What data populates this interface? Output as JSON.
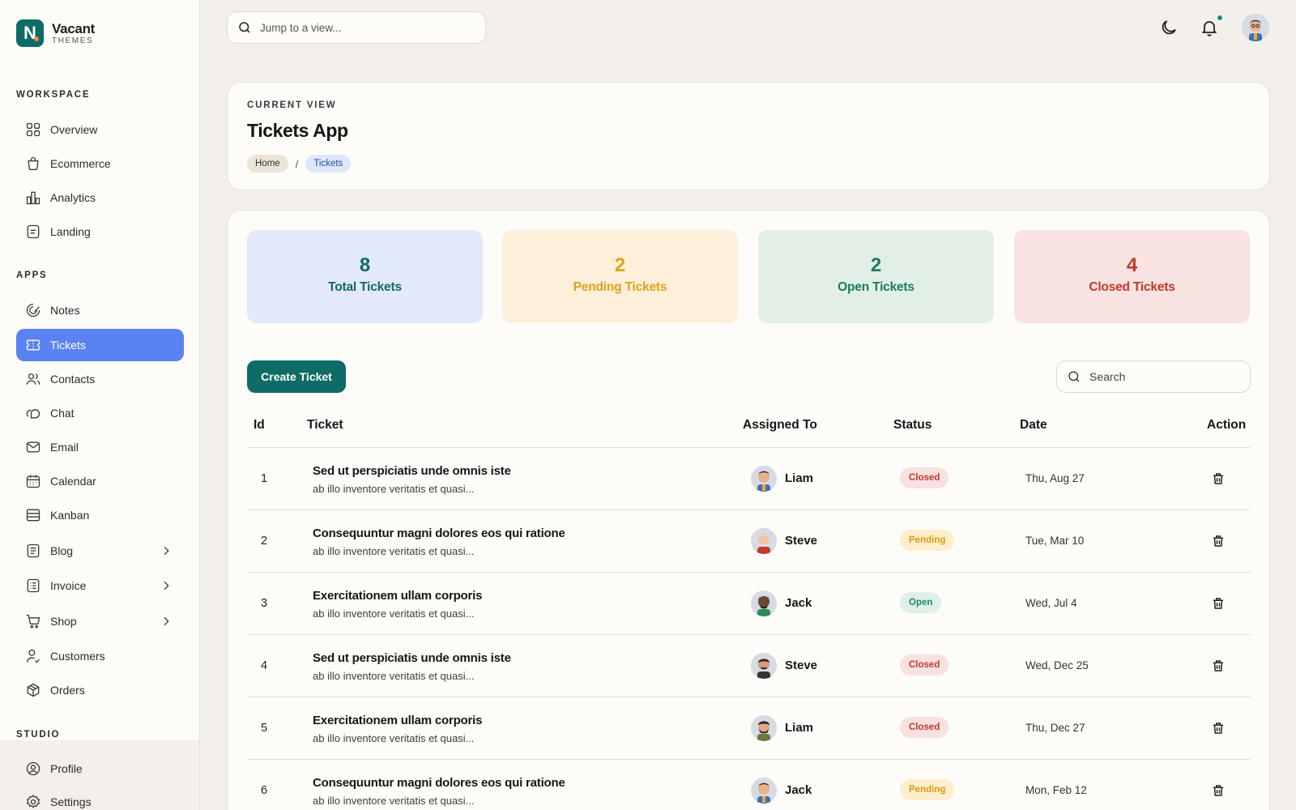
{
  "brand": {
    "name": "Vacant",
    "sub": "THEMES",
    "logo_letter": "N"
  },
  "sidebar": {
    "sections": {
      "workspace": "WORKSPACE",
      "apps": "APPS",
      "studio": "STUDIO"
    },
    "workspace_items": [
      {
        "label": "Overview",
        "icon": "grid-icon"
      },
      {
        "label": "Ecommerce",
        "icon": "bag-icon"
      },
      {
        "label": "Analytics",
        "icon": "bar-chart-icon"
      },
      {
        "label": "Landing",
        "icon": "document-icon"
      }
    ],
    "app_items": [
      {
        "label": "Notes",
        "icon": "notes-icon"
      },
      {
        "label": "Tickets",
        "icon": "ticket-icon",
        "active": true
      },
      {
        "label": "Contacts",
        "icon": "users-icon"
      },
      {
        "label": "Chat",
        "icon": "chat-icon"
      },
      {
        "label": "Email",
        "icon": "mail-icon"
      },
      {
        "label": "Calendar",
        "icon": "calendar-icon"
      },
      {
        "label": "Kanban",
        "icon": "kanban-icon"
      },
      {
        "label": "Blog",
        "icon": "blog-icon",
        "has_children": true
      },
      {
        "label": "Invoice",
        "icon": "invoice-icon",
        "has_children": true
      },
      {
        "label": "Shop",
        "icon": "cart-icon",
        "has_children": true
      },
      {
        "label": "Customers",
        "icon": "customers-icon"
      },
      {
        "label": "Orders",
        "icon": "box-icon"
      }
    ],
    "studio_items": [
      {
        "label": "Profile",
        "icon": "profile-icon"
      },
      {
        "label": "Settings",
        "icon": "settings-icon"
      }
    ]
  },
  "topbar": {
    "search_placeholder": "Jump to a view..."
  },
  "header": {
    "label": "CURRENT VIEW",
    "title": "Tickets App",
    "breadcrumb": [
      "Home",
      "Tickets"
    ],
    "separator": "/"
  },
  "stats": [
    {
      "value": "8",
      "label": "Total Tickets",
      "bg": "#e3e9f9",
      "color": "#0e6b66"
    },
    {
      "value": "2",
      "label": "Pending Tickets",
      "bg": "#fdefd9",
      "color": "#e0a21a"
    },
    {
      "value": "2",
      "label": "Open Tickets",
      "bg": "#e2efe7",
      "color": "#1e7a62"
    },
    {
      "value": "4",
      "label": "Closed Tickets",
      "bg": "#f8e3e1",
      "color": "#c0392b"
    }
  ],
  "actions": {
    "create_label": "Create Ticket",
    "search_placeholder": "Search"
  },
  "table": {
    "columns": [
      "Id",
      "Ticket",
      "Assigned To",
      "Status",
      "Date",
      "Action"
    ],
    "rows": [
      {
        "id": "1",
        "title": "Sed ut perspiciatis unde omnis iste",
        "desc": "ab illo inventore veritatis et quasi...",
        "assignee": "Liam",
        "status": "Closed",
        "date": "Thu, Aug 27"
      },
      {
        "id": "2",
        "title": "Consequuntur magni dolores eos qui ratione",
        "desc": "ab illo inventore veritatis et quasi...",
        "assignee": "Steve",
        "status": "Pending",
        "date": "Tue, Mar 10"
      },
      {
        "id": "3",
        "title": "Exercitationem ullam corporis",
        "desc": "ab illo inventore veritatis et quasi...",
        "assignee": "Jack",
        "status": "Open",
        "date": "Wed, Jul 4"
      },
      {
        "id": "4",
        "title": "Sed ut perspiciatis unde omnis iste",
        "desc": "ab illo inventore veritatis et quasi...",
        "assignee": "Steve",
        "status": "Closed",
        "date": "Wed, Dec 25"
      },
      {
        "id": "5",
        "title": "Exercitationem ullam corporis",
        "desc": "ab illo inventore veritatis et quasi...",
        "assignee": "Liam",
        "status": "Closed",
        "date": "Thu, Dec 27"
      },
      {
        "id": "6",
        "title": "Consequuntur magni dolores eos qui ratione",
        "desc": "ab illo inventore veritatis et quasi...",
        "assignee": "Jack",
        "status": "Pending",
        "date": "Mon, Feb 12"
      }
    ]
  },
  "colors": {
    "accent": "#0e6b66",
    "active_nav": "#5b82f2",
    "notification_dot": "#138b7d"
  }
}
